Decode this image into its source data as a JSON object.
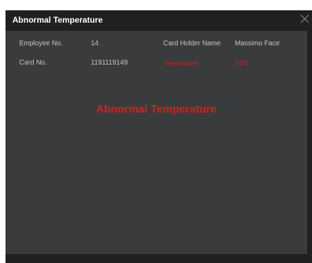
{
  "dialog": {
    "title": "Abnormal Temperature",
    "close_icon": "close-icon"
  },
  "fields": {
    "employee_no_label": "Employee No.",
    "employee_no_value": "14",
    "card_holder_label": "Card Holder Name",
    "card_holder_value": "Massimo Face",
    "card_no_label": "Card No.",
    "card_no_value": "1191119149",
    "temperature_label": "Temperature",
    "temperature_value": "44°C"
  },
  "alert": {
    "message": "Abnormal Temperature"
  },
  "colors": {
    "alert": "#e01b1b",
    "dialog_bg": "#202022",
    "panel_bg": "#3a3b3d"
  }
}
